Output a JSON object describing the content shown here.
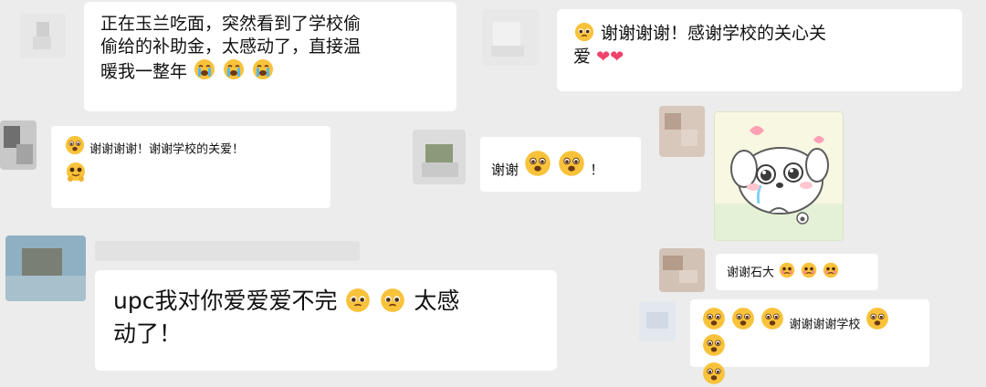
{
  "screenshot": {
    "colors": {
      "background": "#ececec",
      "bubble": "#ffffff",
      "text": "#111111",
      "heart": "#f0436b",
      "emoji_yellow": "#f8c23a"
    }
  },
  "messages": [
    {
      "segments": [
        {
          "text": "正在玉兰吃面，突然看到了学校偷"
        },
        {
          "text": "偷给的补助金，太感动了，直接温"
        },
        {
          "text": "暖我一整年"
        }
      ],
      "emojis": [
        "crying-emoji",
        "crying-emoji",
        "crying-emoji"
      ]
    },
    {
      "prefix_emoji": "pleading-emoji",
      "segments": [
        {
          "text": "谢谢谢谢！感谢学校的关心关"
        },
        {
          "text": "爱"
        }
      ],
      "emojis": [
        "heart-icon",
        "heart-icon"
      ]
    },
    {
      "prefix_emoji": "touched-emoji",
      "text": "谢谢谢谢！谢谢学校的关爱！",
      "trailing_emoji": "hug-emoji"
    },
    {
      "text": "谢谢",
      "emojis": [
        "touched-emoji",
        "touched-emoji"
      ],
      "suffix": "！"
    },
    {
      "sticker": "crying-puppy-sticker"
    },
    {
      "text": "谢谢石大",
      "emojis": [
        "tearful-emoji",
        "tearful-emoji",
        "tearful-emoji"
      ]
    },
    {
      "segments": [
        {
          "text": "upc我对你爱爱爱不完"
        },
        {
          "text": "太感"
        },
        {
          "text": "动了！"
        }
      ],
      "emojis": [
        "pleading-emoji",
        "pleading-emoji"
      ]
    },
    {
      "text": "谢谢谢谢学校",
      "emojis_before": [
        "touched-emoji",
        "touched-emoji",
        "touched-emoji"
      ],
      "emojis_after": [
        "touched-emoji",
        "touched-emoji",
        "touched-emoji"
      ]
    }
  ]
}
